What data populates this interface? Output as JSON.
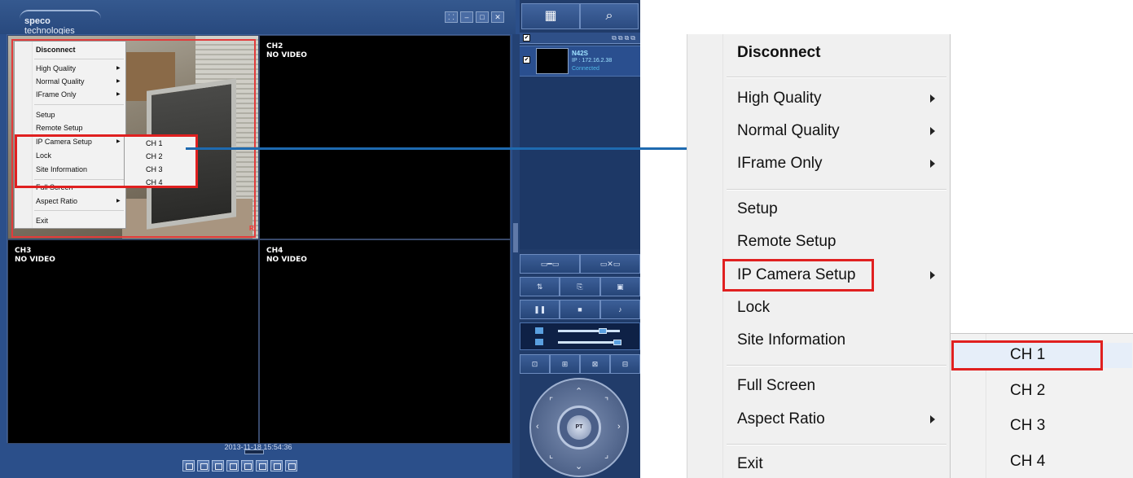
{
  "app": {
    "logo_brand": "speco",
    "logo_rest": " technologies",
    "window_buttons": [
      "⸬",
      "–",
      "□",
      "✕"
    ]
  },
  "video": {
    "channels": [
      {
        "label": "",
        "status": ""
      },
      {
        "label": "CH2",
        "status": "NO VIDEO"
      },
      {
        "label": "CH3",
        "status": "NO VIDEO"
      },
      {
        "label": "CH4",
        "status": "NO VIDEO"
      }
    ],
    "record_tag": "R",
    "timestamp": "2013-11-18 15:54:36"
  },
  "site_panel": {
    "name": "N42S",
    "ip": "IP : 172.16.2.38",
    "status": "Connected"
  },
  "context_menu": {
    "items": [
      {
        "label": "Disconnect",
        "bold": true
      },
      {
        "label": "High Quality",
        "submenu": true
      },
      {
        "label": "Normal Quality",
        "submenu": true
      },
      {
        "label": "IFrame Only",
        "submenu": true
      },
      {
        "label": "Setup"
      },
      {
        "label": "Remote Setup"
      },
      {
        "label": "IP Camera Setup",
        "submenu": true
      },
      {
        "label": "Lock"
      },
      {
        "label": "Site Information"
      },
      {
        "label": "Full Screen"
      },
      {
        "label": "Aspect Ratio",
        "submenu": true
      },
      {
        "label": "Exit"
      }
    ],
    "ip_camera_submenu": [
      "CH 1",
      "CH 2",
      "CH 3",
      "CH 4"
    ]
  },
  "ptz": {
    "center_label": "PT"
  },
  "colors": {
    "app_bg": "#2b4f8a",
    "highlight_red": "#e02020",
    "arrow_blue": "#1e6ab0",
    "site_text": "#9fe2ff"
  }
}
